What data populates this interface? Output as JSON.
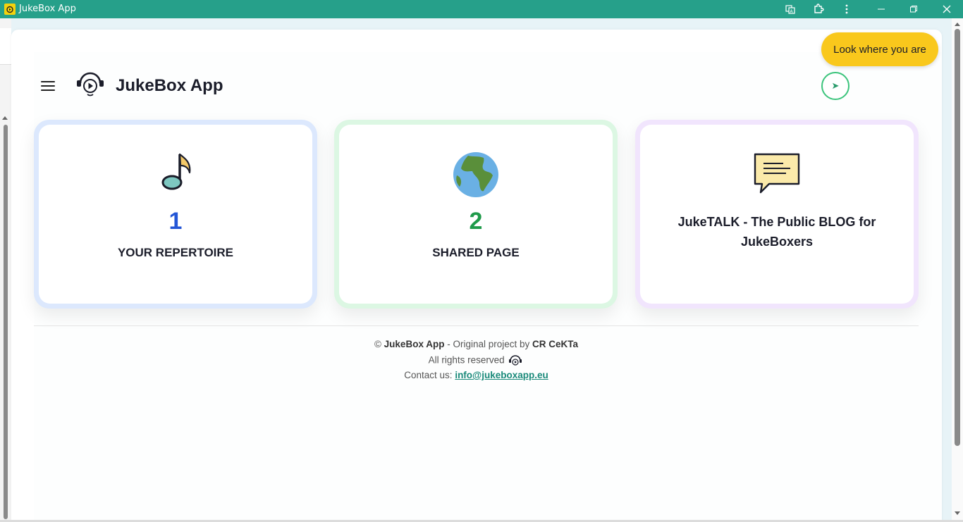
{
  "window": {
    "title": "JukeBox App",
    "accent": "#26a08a"
  },
  "header": {
    "brand": "JukeBox App",
    "bubble_text": "Look where you are",
    "go_button_glyph": "➤"
  },
  "cards": [
    {
      "number": "1",
      "label": "YOUR REPERTOIRE",
      "icon": "music-note-icon",
      "number_color": "#2456d6"
    },
    {
      "number": "2",
      "label": "SHARED PAGE",
      "icon": "globe-icon",
      "number_color": "#1f9a4a"
    },
    {
      "label": "JukeTALK - The Public BLOG for JukeBoxers",
      "icon": "speech-bubble-icon"
    }
  ],
  "footer": {
    "copyright_symbol": "©",
    "brand": "JukeBox App",
    "original_by": "- Original project by",
    "author": "CR CeKTa",
    "rights": "All rights reserved",
    "contact_label": "Contact us:",
    "contact_email": "info@jukeboxapp.eu"
  }
}
